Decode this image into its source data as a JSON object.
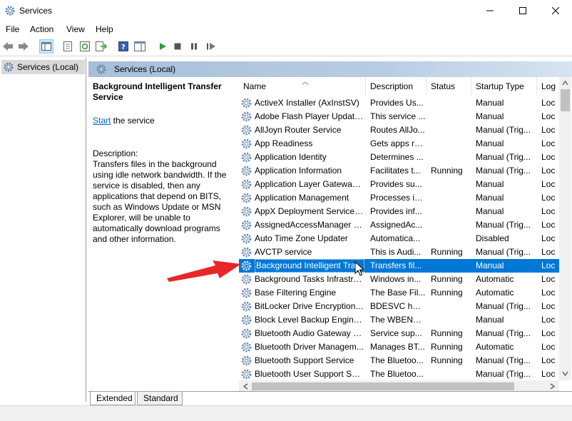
{
  "window": {
    "title": "Services"
  },
  "menu": [
    "File",
    "Action",
    "View",
    "Help"
  ],
  "tree": {
    "root": "Services (Local)"
  },
  "panel": {
    "header": "Services (Local)"
  },
  "description_pane": {
    "service_name": "Background Intelligent Transfer Service",
    "start_link": "Start",
    "start_suffix": " the service",
    "desc_label": "Description:",
    "desc_text": "Transfers files in the background using idle network bandwidth. If the service is disabled, then any applications that depend on BITS, such as Windows Update or MSN Explorer, will be unable to automatically download programs and other information."
  },
  "columns": [
    "Name",
    "Description",
    "Status",
    "Startup Type",
    "Log"
  ],
  "services": [
    {
      "name": "ActiveX Installer (AxInstSV)",
      "desc": "Provides Us...",
      "status": "",
      "startup": "Manual",
      "log": "Loc"
    },
    {
      "name": "Adobe Flash Player Update ...",
      "desc": "This service ...",
      "status": "",
      "startup": "Manual",
      "log": "Loc"
    },
    {
      "name": "AllJoyn Router Service",
      "desc": "Routes AllJo...",
      "status": "",
      "startup": "Manual (Trig...",
      "log": "Loc"
    },
    {
      "name": "App Readiness",
      "desc": "Gets apps re...",
      "status": "",
      "startup": "Manual",
      "log": "Loc"
    },
    {
      "name": "Application Identity",
      "desc": "Determines ...",
      "status": "",
      "startup": "Manual (Trig...",
      "log": "Loc"
    },
    {
      "name": "Application Information",
      "desc": "Facilitates t...",
      "status": "Running",
      "startup": "Manual (Trig...",
      "log": "Loc"
    },
    {
      "name": "Application Layer Gateway ...",
      "desc": "Provides su...",
      "status": "",
      "startup": "Manual",
      "log": "Loc"
    },
    {
      "name": "Application Management",
      "desc": "Processes in...",
      "status": "",
      "startup": "Manual",
      "log": "Loc"
    },
    {
      "name": "AppX Deployment Service (...",
      "desc": "Provides inf...",
      "status": "",
      "startup": "Manual",
      "log": "Loc"
    },
    {
      "name": "AssignedAccessManager Se...",
      "desc": "AssignedAc...",
      "status": "",
      "startup": "Manual (Trig...",
      "log": "Loc"
    },
    {
      "name": "Auto Time Zone Updater",
      "desc": "Automatica...",
      "status": "",
      "startup": "Disabled",
      "log": "Loc"
    },
    {
      "name": "AVCTP service",
      "desc": "This is Audi...",
      "status": "Running",
      "startup": "Manual (Trig...",
      "log": "Loc"
    },
    {
      "name": "Background Intelligent Tra...",
      "desc": "Transfers fil...",
      "status": "",
      "startup": "Manual",
      "log": "Loc",
      "selected": true
    },
    {
      "name": "Background Tasks Infrastru...",
      "desc": "Windows in...",
      "status": "Running",
      "startup": "Automatic",
      "log": "Loc"
    },
    {
      "name": "Base Filtering Engine",
      "desc": "The Base Fil...",
      "status": "Running",
      "startup": "Automatic",
      "log": "Loc"
    },
    {
      "name": "BitLocker Drive Encryption ...",
      "desc": "BDESVC hos...",
      "status": "",
      "startup": "Manual (Trig...",
      "log": "Loc"
    },
    {
      "name": "Block Level Backup Engine ...",
      "desc": "The WBENG...",
      "status": "",
      "startup": "Manual",
      "log": "Loc"
    },
    {
      "name": "Bluetooth Audio Gateway S...",
      "desc": "Service sup...",
      "status": "Running",
      "startup": "Manual (Trig...",
      "log": "Loc"
    },
    {
      "name": "Bluetooth Driver Managem...",
      "desc": "Manages BT...",
      "status": "Running",
      "startup": "Automatic",
      "log": "Loc"
    },
    {
      "name": "Bluetooth Support Service",
      "desc": "The Bluetoo...",
      "status": "Running",
      "startup": "Manual (Trig...",
      "log": "Loc"
    },
    {
      "name": "Bluetooth User Support Ser...",
      "desc": "The Bluetoo...",
      "status": "",
      "startup": "Manual (Trig...",
      "log": "Loc"
    }
  ],
  "tabs": [
    "Extended",
    "Standard"
  ],
  "colors": {
    "selection": "#0078d7",
    "link": "#0066cc",
    "annotation_arrow": "#e8262a"
  }
}
